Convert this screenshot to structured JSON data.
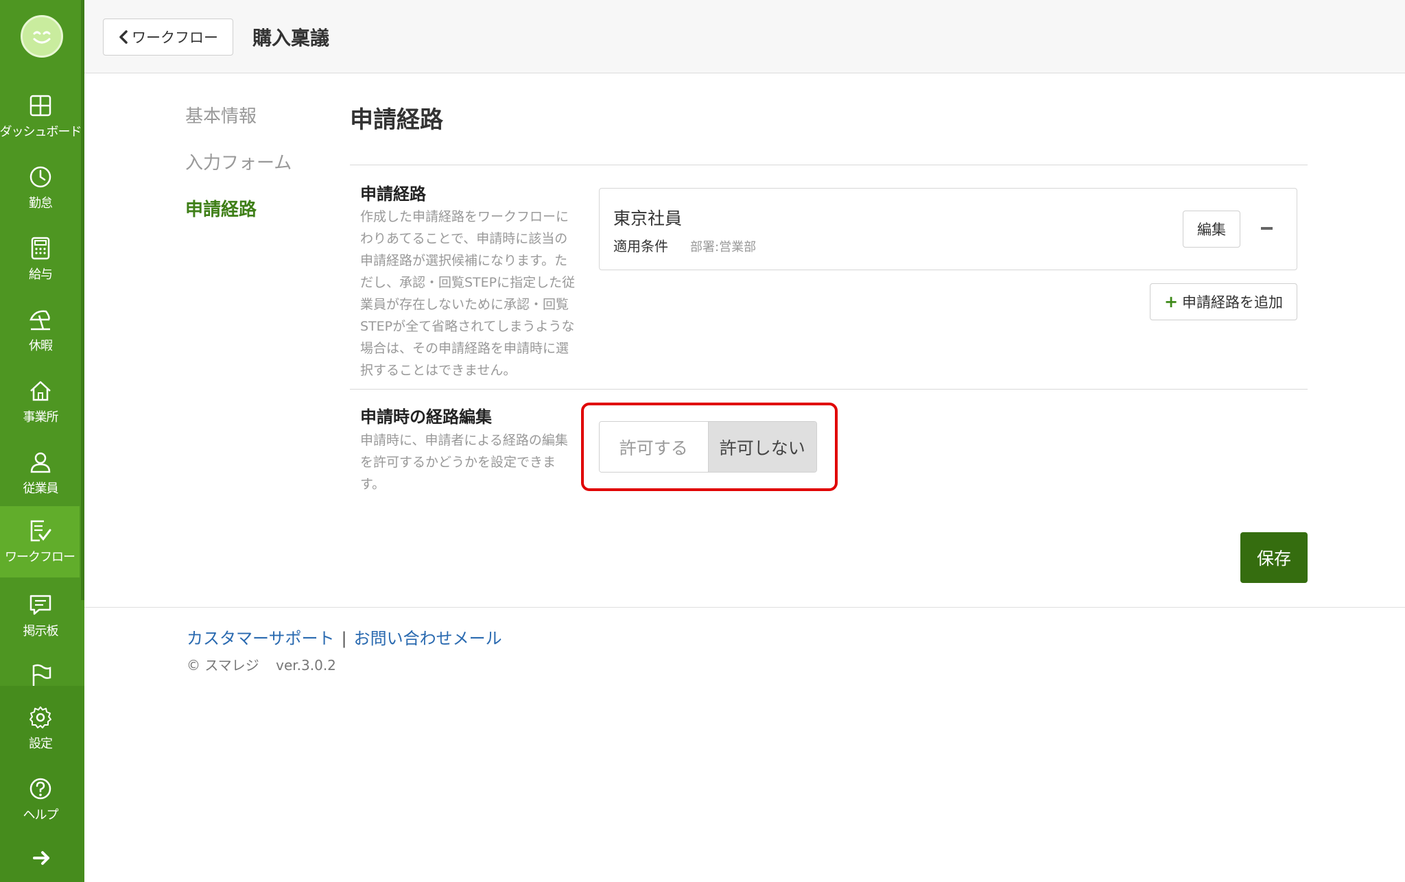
{
  "sidebar": {
    "items": [
      {
        "label": "ダッシュボード",
        "icon": "dashboard-icon"
      },
      {
        "label": "勤怠",
        "icon": "clock-icon"
      },
      {
        "label": "給与",
        "icon": "calculator-icon"
      },
      {
        "label": "休暇",
        "icon": "beach-umbrella-icon"
      },
      {
        "label": "事業所",
        "icon": "home-icon"
      },
      {
        "label": "従業員",
        "icon": "person-icon"
      },
      {
        "label": "ワークフロー",
        "icon": "workflow-check-icon",
        "active": true
      },
      {
        "label": "掲示板",
        "icon": "message-board-icon"
      },
      {
        "label": "",
        "icon": "flag-icon"
      },
      {
        "label": "設定",
        "icon": "gear-icon"
      },
      {
        "label": "ヘルプ",
        "icon": "help-icon"
      }
    ]
  },
  "header": {
    "back_label": "ワークフロー",
    "title": "購入稟議"
  },
  "tabs": [
    {
      "label": "基本情報"
    },
    {
      "label": "入力フォーム"
    },
    {
      "label": "申請経路",
      "active": true
    }
  ],
  "main": {
    "section_title": "申請経路",
    "route_field": {
      "label": "申請経路",
      "description": "作成した申請経路をワークフローにわりあてることで、申請時に該当の申請経路が選択候補になります。ただし、承認・回覧STEPに指定した従業員が存在しないために承認・回覧STEPが全て省略されてしまうような場合は、その申請経路を申請時に選択することはできません。",
      "routes": [
        {
          "name": "東京社員",
          "condition_label": "適用条件",
          "condition_value": "部署:営業部",
          "edit_label": "編集"
        }
      ],
      "add_label": "申請経路を追加"
    },
    "edit_field": {
      "label": "申請時の経路編集",
      "description": "申請時に、申請者による経路の編集を許可するかどうかを設定できます。",
      "options": [
        "許可する",
        "許可しない"
      ],
      "selected": "許可しない"
    },
    "save_label": "保存"
  },
  "footer": {
    "support_link": "カスタマーサポート",
    "separator": "|",
    "mail_link": "お問い合わせメール",
    "copyright": "© スマレジ",
    "version": "ver.3.0.2"
  },
  "colors": {
    "sidebar": "#4e9622",
    "sidebar_active": "#61ad2b",
    "accent": "#356d0f",
    "highlight": "#e00000",
    "link": "#2a6ab0"
  }
}
